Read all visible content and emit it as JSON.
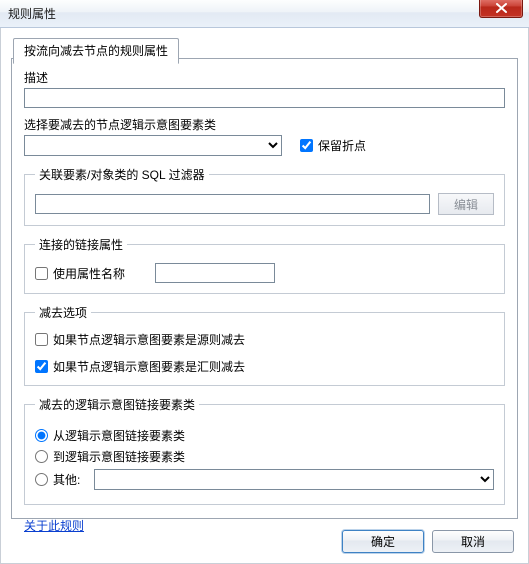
{
  "window": {
    "title": "规则属性"
  },
  "tabs": {
    "main_label": "按流向减去节点的规则属性"
  },
  "form": {
    "desc_label": "描述",
    "desc_value": "",
    "select_class_label": "选择要减去的节点逻辑示意图要素类",
    "select_class_value": "",
    "preserve_vertices_label": "保留折点",
    "preserve_vertices_checked": true
  },
  "sql": {
    "legend": "关联要素/对象类的 SQL 过滤器",
    "value": "",
    "edit_label": "编辑"
  },
  "conn": {
    "legend": "连接的链接属性",
    "use_prop_name_label": "使用属性名称",
    "use_prop_name_checked": false,
    "prop_name_value": ""
  },
  "sub": {
    "legend": "减去选项",
    "if_source_label": "如果节点逻辑示意图要素是源则减去",
    "if_source_checked": false,
    "if_sink_label": "如果节点逻辑示意图要素是汇则减去",
    "if_sink_checked": true
  },
  "linkclass": {
    "legend": "减去的逻辑示意图链接要素类",
    "opt_from_label": "从逻辑示意图链接要素类",
    "opt_to_label": "到逻辑示意图链接要素类",
    "opt_other_label": "其他:",
    "selected": "from",
    "other_value": ""
  },
  "links": {
    "about": "关于此规则"
  },
  "buttons": {
    "ok": "确定",
    "cancel": "取消"
  }
}
